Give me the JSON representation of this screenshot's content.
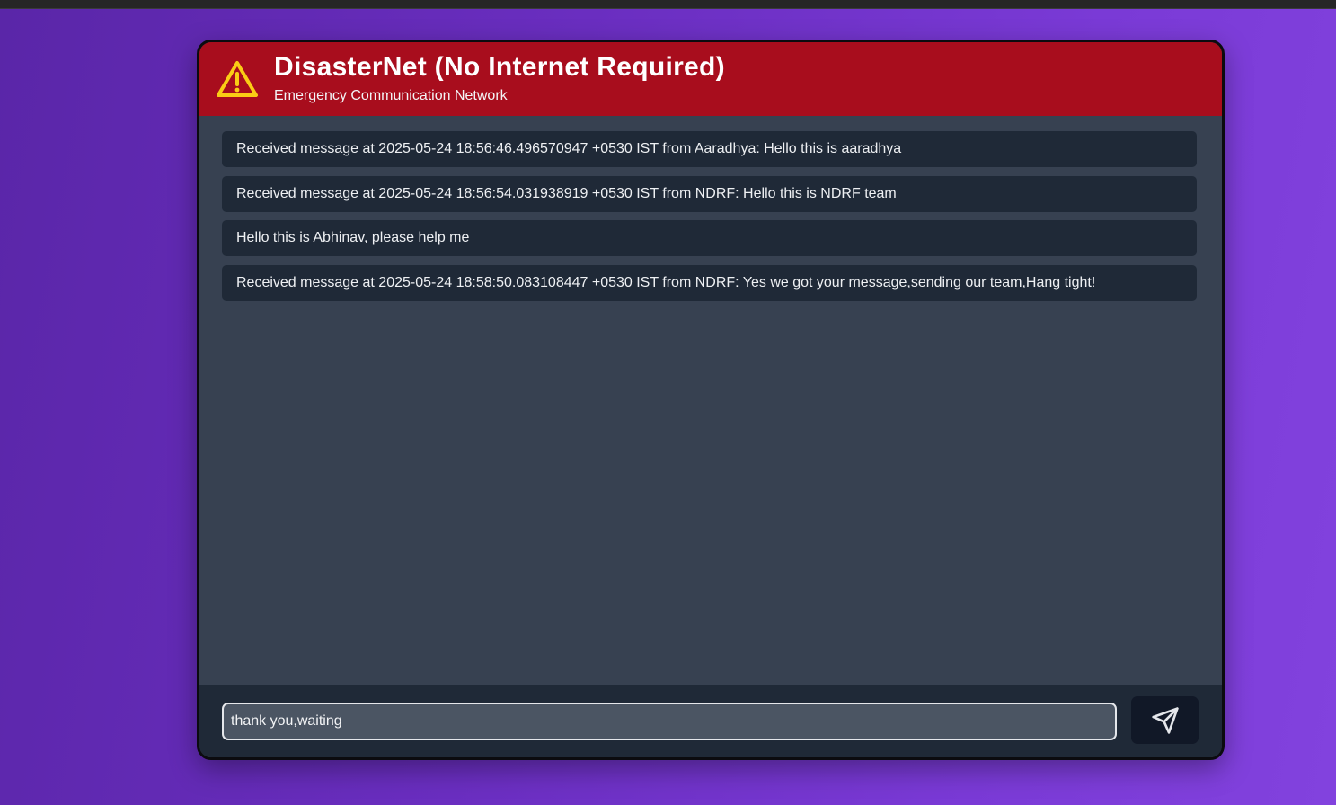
{
  "header": {
    "title": "DisasterNet (No Internet Required)",
    "subtitle": "Emergency Communication Network",
    "icon": "warning-triangle-icon",
    "background_color": "#a80d1d",
    "icon_color": "#facc15"
  },
  "messages": [
    {
      "text": "Received message at 2025-05-24 18:56:46.496570947 +0530 IST from Aaradhya: Hello this is aaradhya"
    },
    {
      "text": "Received message at 2025-05-24 18:56:54.031938919 +0530 IST from NDRF: Hello this is NDRF team"
    },
    {
      "text": "Hello this is Abhinav, please help me"
    },
    {
      "text": "Received message at 2025-05-24 18:58:50.083108447 +0530 IST from NDRF: Yes we got your message,sending our team,Hang tight!"
    }
  ],
  "composer": {
    "input_value": "thank you,waiting",
    "send_icon": "send-icon"
  },
  "colors": {
    "panel": "#374151",
    "message_bg": "#1f2937",
    "input_bg": "#4b5563",
    "send_button_bg": "#111827"
  }
}
